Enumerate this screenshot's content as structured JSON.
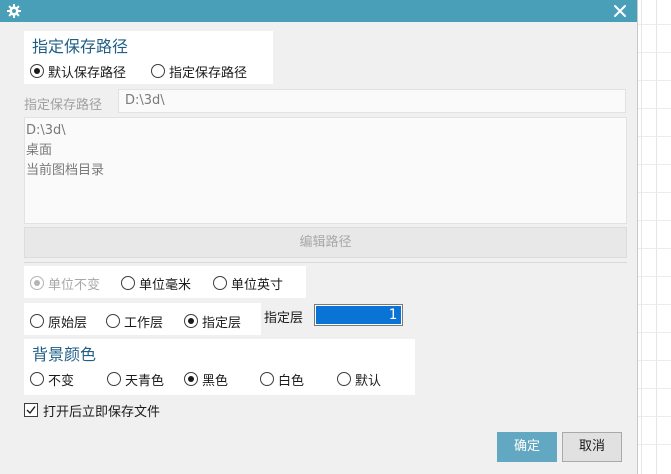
{
  "window": {
    "settings_icon": "gear-icon",
    "close_icon": "close-icon",
    "accent": "#4a9fb8"
  },
  "save_path": {
    "title": "指定保存路径",
    "options": [
      "默认保存路径",
      "指定保存路径"
    ],
    "selected": "默认保存路径",
    "field_label": "指定保存路径",
    "field_value": "D:\\3d\\",
    "list": [
      "D:\\3d\\",
      "桌面",
      "当前图档目录"
    ],
    "edit_button": "编辑路径"
  },
  "units": {
    "options": [
      "单位不变",
      "单位毫米",
      "单位英寸"
    ],
    "selected": "单位不变"
  },
  "layer": {
    "options": [
      "原始层",
      "工作层",
      "指定层"
    ],
    "selected": "指定层",
    "label": "指定层",
    "value": "1"
  },
  "background": {
    "title": "背景颜色",
    "options": [
      "不变",
      "天青色",
      "黑色",
      "白色",
      "默认"
    ],
    "selected": "黑色"
  },
  "save_on_open": {
    "label": "打开后立即保存文件",
    "checked": true
  },
  "buttons": {
    "ok": "确定",
    "cancel": "取消"
  }
}
